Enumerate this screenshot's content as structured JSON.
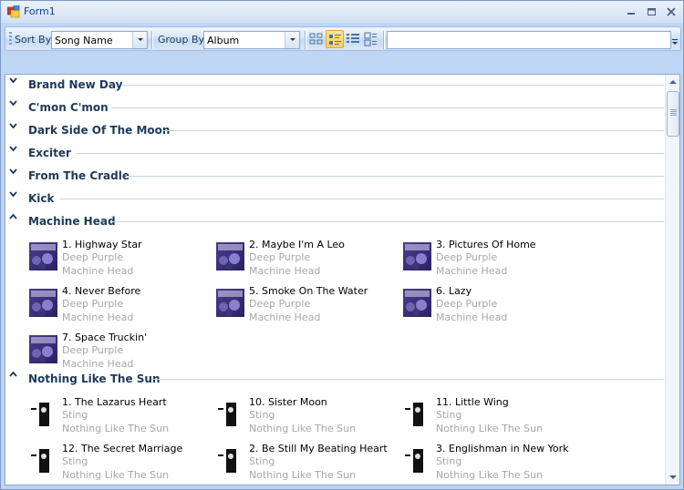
{
  "window": {
    "title": "Form1"
  },
  "toolbar": {
    "sort_label": "Sort By:",
    "sort_value": "Song Name",
    "group_label": "Group By:",
    "group_value": "Album",
    "filter_value": ""
  },
  "groups": [
    {
      "title": "Brand New Day",
      "expanded": false
    },
    {
      "title": "C'mon C'mon",
      "expanded": false
    },
    {
      "title": "Dark Side Of The Moon",
      "expanded": false
    },
    {
      "title": "Exciter",
      "expanded": false
    },
    {
      "title": "From The Cradle",
      "expanded": false
    },
    {
      "title": "Kick",
      "expanded": false
    },
    {
      "title": "Machine Head",
      "expanded": true,
      "items": [
        {
          "title": "1. Highway Star",
          "artist": "Deep Purple",
          "album": "Machine Head"
        },
        {
          "title": "2. Maybe I'm A Leo",
          "artist": "Deep Purple",
          "album": "Machine Head"
        },
        {
          "title": "3. Pictures Of Home",
          "artist": "Deep Purple",
          "album": "Machine Head"
        },
        {
          "title": "4. Never Before",
          "artist": "Deep Purple",
          "album": "Machine Head"
        },
        {
          "title": "5. Smoke On The Water",
          "artist": "Deep Purple",
          "album": "Machine Head"
        },
        {
          "title": "6. Lazy",
          "artist": "Deep Purple",
          "album": "Machine Head"
        },
        {
          "title": "7. Space Truckin'",
          "artist": "Deep Purple",
          "album": "Machine Head"
        }
      ]
    },
    {
      "title": "Nothing Like The Sun",
      "expanded": true,
      "items": [
        {
          "title": "1. The Lazarus Heart",
          "artist": "Sting",
          "album": "Nothing Like The Sun"
        },
        {
          "title": "10. Sister Moon",
          "artist": "Sting",
          "album": "Nothing Like The Sun"
        },
        {
          "title": "11. Little Wing",
          "artist": "Sting",
          "album": "Nothing Like The Sun"
        },
        {
          "title": "12. The Secret Marriage",
          "artist": "Sting",
          "album": "Nothing Like The Sun"
        },
        {
          "title": "2. Be Still My Beating Heart",
          "artist": "Sting",
          "album": "Nothing Like The Sun"
        },
        {
          "title": "3. Englishman in New York",
          "artist": "Sting",
          "album": "Nothing Like The Sun"
        }
      ]
    }
  ],
  "icons": {
    "app": "form-icon",
    "minimize": "minimize-icon",
    "maximize": "maximize-icon",
    "close": "close-icon",
    "collapsed": "chevron-down-icon",
    "expanded": "chevron-up-icon",
    "view_buttons": [
      "view-large-icons-icon",
      "view-tiles-icon",
      "view-details-icon",
      "view-list-icon"
    ],
    "overflow": "toolbar-overflow-icon"
  },
  "colors": {
    "group_title": "#1e395b",
    "subtext": "#a7a7a7",
    "active_button": "#ffcf5c"
  }
}
